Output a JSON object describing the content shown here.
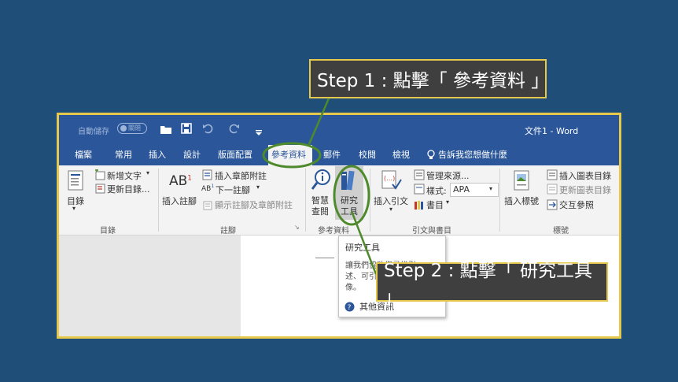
{
  "callouts": {
    "step1": "Step 1 : 點擊「 參考資料 」",
    "step2": "Step 2 : 點擊「 研究工具 」"
  },
  "titlebar": {
    "autosave_label": "自動儲存",
    "autosave_toggle": "關閉",
    "window_title": "文件1 - Word"
  },
  "tabs": [
    "檔案",
    "常用",
    "插入",
    "設計",
    "版面配置",
    "參考資料",
    "郵件",
    "校閱",
    "檢視"
  ],
  "tell_me": "告訴我您想做什麼",
  "ribbon": {
    "toc": {
      "button": "目錄",
      "add_text": "新增文字",
      "update": "更新目錄...",
      "group": "目錄"
    },
    "footnotes": {
      "insert_footnote": "插入註腳",
      "insert_endnote": "插入章節附註",
      "next_footnote": "下一註腳",
      "show_notes": "顯示註腳及章節附註",
      "group": "註腳"
    },
    "research": {
      "smart_lookup_1": "智慧",
      "smart_lookup_2": "查閱",
      "researcher_1": "研究",
      "researcher_2": "工具",
      "group": "參考資料"
    },
    "citations": {
      "insert_citation": "插入引文",
      "manage_sources": "管理來源...",
      "style_label": "樣式:",
      "style_value": "APA",
      "bibliography": "書目",
      "group": "引文與書目"
    },
    "captions": {
      "insert_caption": "插入標號",
      "insert_table_of_figures": "插入圖表目錄",
      "update_table": "更新圖表目錄",
      "cross_reference": "交互參照",
      "group": "標號"
    }
  },
  "dropdown": {
    "title": "研究工具",
    "desc_1": "讓我們協助您尋找引",
    "desc_2": "述、可引",
    "desc_3": "像。",
    "more": "其他資訊"
  },
  "colors": {
    "background": "#1f4e79",
    "word_blue": "#2b579a",
    "highlight": "#e6c84d",
    "circle": "#4e8a2c"
  }
}
